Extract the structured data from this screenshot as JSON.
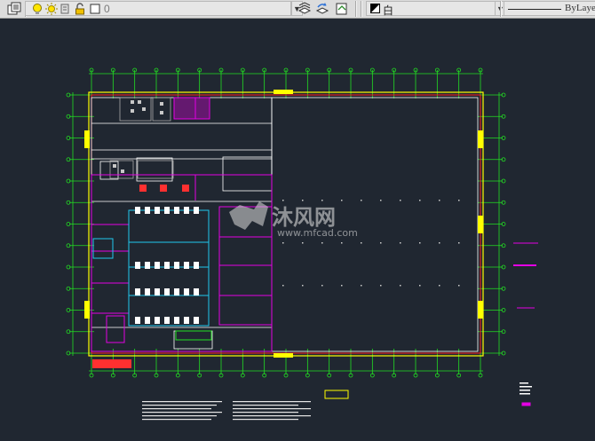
{
  "toolbar": {
    "layer_name": "0",
    "color_value": "白",
    "linetype_value": "ByLaye"
  },
  "icons": [
    "layer-properties-icon",
    "bulb-icon",
    "sun-icon",
    "paintbrush-icon",
    "lock-icon",
    "layer-color-square-icon",
    "make-current-icon",
    "layer-previous-icon",
    "layer-state-icon",
    "color-swatch-icon"
  ],
  "colors": {
    "canvas": "#202731",
    "grid": "#22e022",
    "walls": "#ffffff",
    "rooms": "#e400e4",
    "equipment": "#21c8ee",
    "border": "#ffff00",
    "boundary": "#ff2222"
  },
  "watermark": {
    "brand_cn": "沐风网",
    "url": "www.mfcad.com"
  }
}
